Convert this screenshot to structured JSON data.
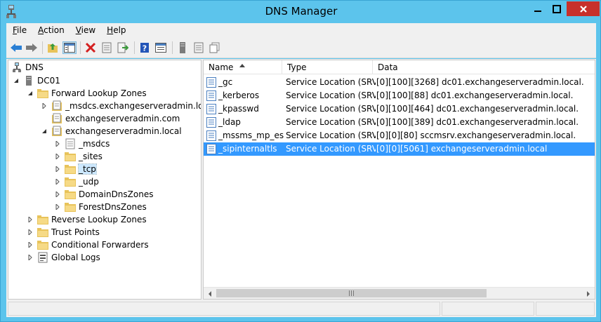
{
  "window": {
    "title": "DNS Manager",
    "title_bar_color": "#5cc4ec",
    "close_button_color": "#c7302b"
  },
  "menu": [
    "File",
    "Action",
    "View",
    "Help"
  ],
  "toolbar": {
    "buttons": [
      "back-icon",
      "forward-icon",
      "up-folder-icon",
      "show-tree-icon",
      "delete-icon",
      "properties-icon",
      "export-icon",
      "help-icon",
      "console-view-icon",
      "server-icon",
      "list-icon",
      "copy-icon"
    ]
  },
  "tree": {
    "root": "DNS",
    "server": "DC01",
    "forward_zones": "Forward Lookup Zones",
    "zone_msdcs": "_msdcs.exchangeserveradmin.local",
    "zone_exchange_com": "exchangeserveradmin.com",
    "zone_exchange_local": "exchangeserveradmin.local",
    "sub_msdcs": "_msdcs",
    "sub_sites": "_sites",
    "sub_tcp": "_tcp",
    "sub_udp": "_udp",
    "sub_domaindns": "DomainDnsZones",
    "sub_forestdns": "ForestDnsZones",
    "reverse_zones": "Reverse Lookup Zones",
    "trust_points": "Trust Points",
    "conditional_forwarders": "Conditional Forwarders",
    "global_logs": "Global Logs"
  },
  "list": {
    "columns": [
      "Name",
      "Type",
      "Data"
    ],
    "rows": [
      {
        "name": "_gc",
        "type": "Service Location (SRV)",
        "data": "[0][100][3268] dc01.exchangeserveradmin.local."
      },
      {
        "name": "_kerberos",
        "type": "Service Location (SRV)",
        "data": "[0][100][88] dc01.exchangeserveradmin.local."
      },
      {
        "name": "_kpasswd",
        "type": "Service Location (SRV)",
        "data": "[0][100][464] dc01.exchangeserveradmin.local."
      },
      {
        "name": "_ldap",
        "type": "Service Location (SRV)",
        "data": "[0][100][389] dc01.exchangeserveradmin.local."
      },
      {
        "name": "_mssms_mp_esa",
        "type": "Service Location (SRV)",
        "data": "[0][0][80] sccmsrv.exchangeserveradmin.local."
      },
      {
        "name": "_sipinternaltls",
        "type": "Service Location (SRV)",
        "data": "[0][0][5061] exchangeserveradmin.local"
      }
    ],
    "selected_index": 5,
    "selection_color": "#3399ff"
  }
}
